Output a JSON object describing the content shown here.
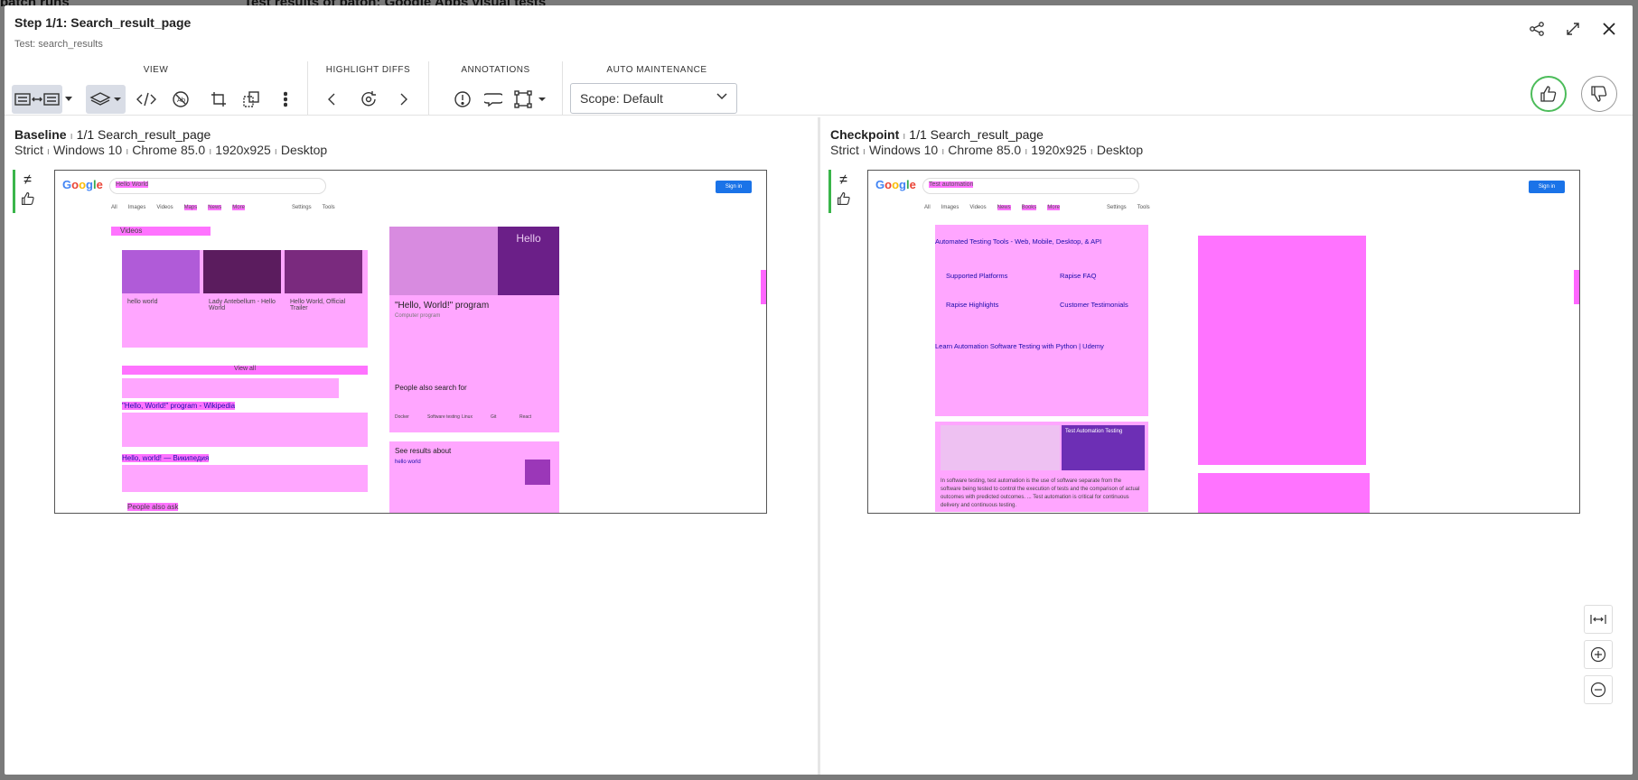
{
  "background": {
    "left_text": "batch runs",
    "center_text": "Test results of baton: Google Apps visual tests"
  },
  "header": {
    "title": "Step 1/1: Search_result_page",
    "subtitle": "Test: search_results",
    "icons": [
      "share-icon",
      "expand-icon",
      "close-icon"
    ]
  },
  "toolbar": {
    "groups": {
      "view": "VIEW",
      "highlight": "HIGHLIGHT DIFFS",
      "annotations": "ANNOTATIONS",
      "auto": "AUTO MAINTENANCE"
    },
    "scope_value": "Scope: Default"
  },
  "baseline": {
    "label": "Baseline",
    "step": "1/1 Search_result_page",
    "match": "Strict",
    "os": "Windows 10",
    "browser": "Chrome 85.0",
    "viewport": "1920x925",
    "device": "Desktop"
  },
  "checkpoint": {
    "label": "Checkpoint",
    "step": "1/1 Search_result_page",
    "match": "Strict",
    "os": "Windows 10",
    "browser": "Chrome 85.0",
    "viewport": "1920x925",
    "device": "Desktop"
  },
  "baseline_shot": {
    "query": "Hello World",
    "signin": "Sign in",
    "tabs": [
      "All",
      "Images",
      "Videos",
      "Maps",
      "News",
      "More",
      "Settings",
      "Tools"
    ],
    "videos_heading": "Videos",
    "video1": "hello world",
    "video2": "Lady Antebellum - Hello World",
    "video3": "Hello World, Official Trailer",
    "view_all": "View all",
    "wiki_title": "\"Hello, World!\" program - Wikipedia",
    "ru_title": "Hello, world! — Википедия",
    "people_also_ask": "People also ask",
    "panel_title": "\"Hello, World!\" program",
    "panel_sub": "Computer program",
    "panel_image_text": "Hello",
    "people_search": "People also search for",
    "ppl": [
      "Docker",
      "Software testing",
      "Linux",
      "Git",
      "React"
    ],
    "see_results": "See results about",
    "see_item": "hello world"
  },
  "checkpoint_shot": {
    "query": "Test automation",
    "signin": "Sign in",
    "tabs": [
      "All",
      "Images",
      "Videos",
      "News",
      "Books",
      "More",
      "Settings",
      "Tools"
    ],
    "ad1_title": "Automated Testing Tools - Web, Mobile, Desktop, & API",
    "sl1": "Supported Platforms",
    "sl2": "Rapise FAQ",
    "sl3": "Rapise Highlights",
    "sl4": "Customer Testimonials",
    "ad2_title": "Learn Automation Software Testing with Python | Udemy",
    "ad3_banner": "Test Automation Testing",
    "snippet": "In software testing, test automation is the use of software separate from the software being tested to control the execution of tests and the comparison of actual outcomes with predicted outcomes. ... Test automation is critical for continuous delivery and continuous testing."
  }
}
